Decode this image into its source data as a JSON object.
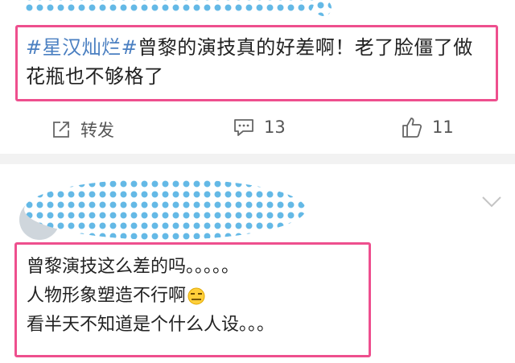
{
  "post": {
    "topic": "#星汉灿烂#",
    "text": "曾黎的演技真的好差啊！老了脸僵了做花瓶也不够格了"
  },
  "actions": {
    "share_label": "转发",
    "comment_count": "13",
    "like_count": "11"
  },
  "comment": {
    "lines": [
      "曾黎演技这么差的吗。。。。。",
      "人物形象塑造不行啊",
      "看半天不知道是个什么人设。。。"
    ]
  },
  "colors": {
    "highlight_box": "#ee4f8e",
    "topic": "#4a7fc1",
    "mask_dots": "#64b9e6"
  },
  "icons": [
    "share-icon",
    "comment-icon",
    "like-icon",
    "chevron-down-icon",
    "emoji-icon"
  ]
}
